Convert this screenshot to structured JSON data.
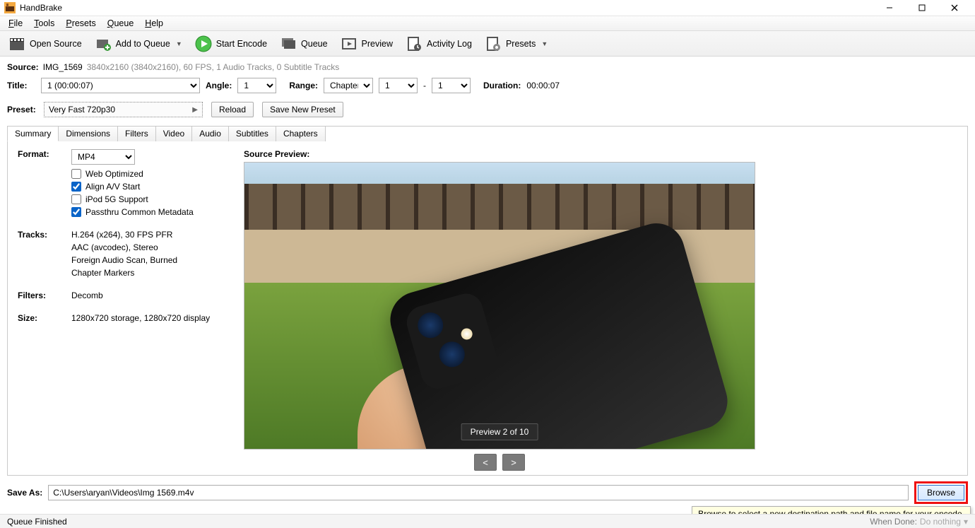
{
  "window": {
    "title": "HandBrake"
  },
  "menu": {
    "file": "File",
    "tools": "Tools",
    "presets": "Presets",
    "queue": "Queue",
    "help": "Help"
  },
  "toolbar": {
    "open_source": "Open Source",
    "add_to_queue": "Add to Queue",
    "start_encode": "Start Encode",
    "queue": "Queue",
    "preview": "Preview",
    "activity_log": "Activity Log",
    "presets": "Presets"
  },
  "source": {
    "label": "Source:",
    "name": "IMG_1569",
    "meta": "3840x2160 (3840x2160), 60 FPS, 1 Audio Tracks, 0 Subtitle Tracks"
  },
  "title_row": {
    "label": "Title:",
    "title_value": "1  (00:00:07)",
    "angle_label": "Angle:",
    "angle_value": "1",
    "range_label": "Range:",
    "range_type": "Chapters",
    "range_from": "1",
    "range_dash": "-",
    "range_to": "1",
    "duration_label": "Duration:",
    "duration_value": "00:00:07"
  },
  "preset_row": {
    "label": "Preset:",
    "value": "Very Fast 720p30",
    "reload": "Reload",
    "save_new": "Save New Preset"
  },
  "tabs": {
    "summary": "Summary",
    "dimensions": "Dimensions",
    "filters": "Filters",
    "video": "Video",
    "audio": "Audio",
    "subtitles": "Subtitles",
    "chapters": "Chapters"
  },
  "summary": {
    "format_label": "Format:",
    "format_value": "MP4",
    "web_optimized": "Web Optimized",
    "align_av": "Align A/V Start",
    "ipod": "iPod 5G Support",
    "passthru": "Passthru Common Metadata",
    "tracks_label": "Tracks:",
    "tracks_lines": [
      "H.264 (x264), 30 FPS PFR",
      "AAC (avcodec), Stereo",
      "Foreign Audio Scan, Burned",
      "Chapter Markers"
    ],
    "filters_label": "Filters:",
    "filters_value": "Decomb",
    "size_label": "Size:",
    "size_value": "1280x720 storage, 1280x720 display",
    "preview_label": "Source Preview:",
    "preview_badge": "Preview 2 of 10",
    "prev": "<",
    "next": ">"
  },
  "saveas": {
    "label": "Save As:",
    "path": "C:\\Users\\aryan\\Videos\\Img 1569.m4v",
    "browse": "Browse"
  },
  "tooltip": "Browse to select a new destination path and file name for your encode.",
  "status": {
    "left": "Queue Finished",
    "right_label": "When Done:",
    "right_value": "Do nothing"
  }
}
